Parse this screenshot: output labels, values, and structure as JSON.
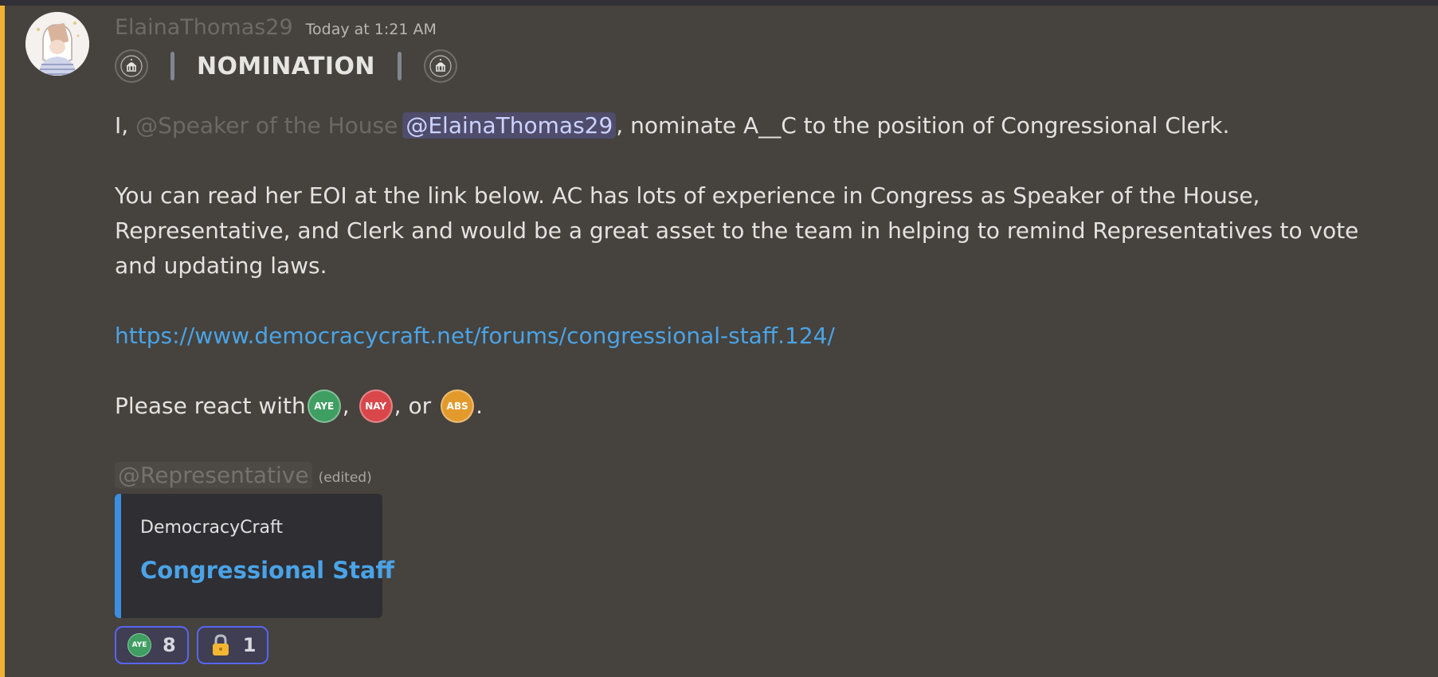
{
  "message": {
    "author": "ElainaThomas29",
    "timestamp": "Today at 1:21 AM",
    "nomination_title": "NOMINATION",
    "line1": {
      "prefix": "I, ",
      "faded_mention": "@Speaker of the House",
      "mention": "@ElainaThomas29",
      "suffix": ", nominate A__C to the position of Congressional Clerk."
    },
    "paragraph2": "You can read her EOI at the link below. AC has lots of experience in Congress as Speaker of the House, Representative, and Clerk and would be a great asset to the team in helping to remind Representatives to vote and updating laws.",
    "link": "https://www.democracycraft.net/forums/congressional-staff.124/",
    "react_line": {
      "prefix": "Please react with ",
      "sep1": ",",
      "sep2": ", or",
      "end": "."
    },
    "react_icons": {
      "aye": {
        "label": "AYE",
        "color": "#3f9e62"
      },
      "nay": {
        "label": "NAY",
        "color": "#d9474a"
      },
      "abs": {
        "label": "ABS",
        "color": "#e39a2c"
      }
    },
    "role_mention": "@Representative",
    "edited": "(edited)"
  },
  "embed": {
    "provider": "DemocracyCraft",
    "title": "Congressional Staff",
    "accent_color": "#3c8ee0"
  },
  "reactions": [
    {
      "icon": "aye-emoji",
      "label": "AYE",
      "count": "8"
    },
    {
      "icon": "lock-emoji",
      "count": "1"
    }
  ],
  "colors": {
    "background": "#46423d",
    "left_accent": "#f0b232",
    "link": "#49a4e8",
    "mention_bg": "#4f4c6c",
    "reaction_border": "#5865f2"
  }
}
